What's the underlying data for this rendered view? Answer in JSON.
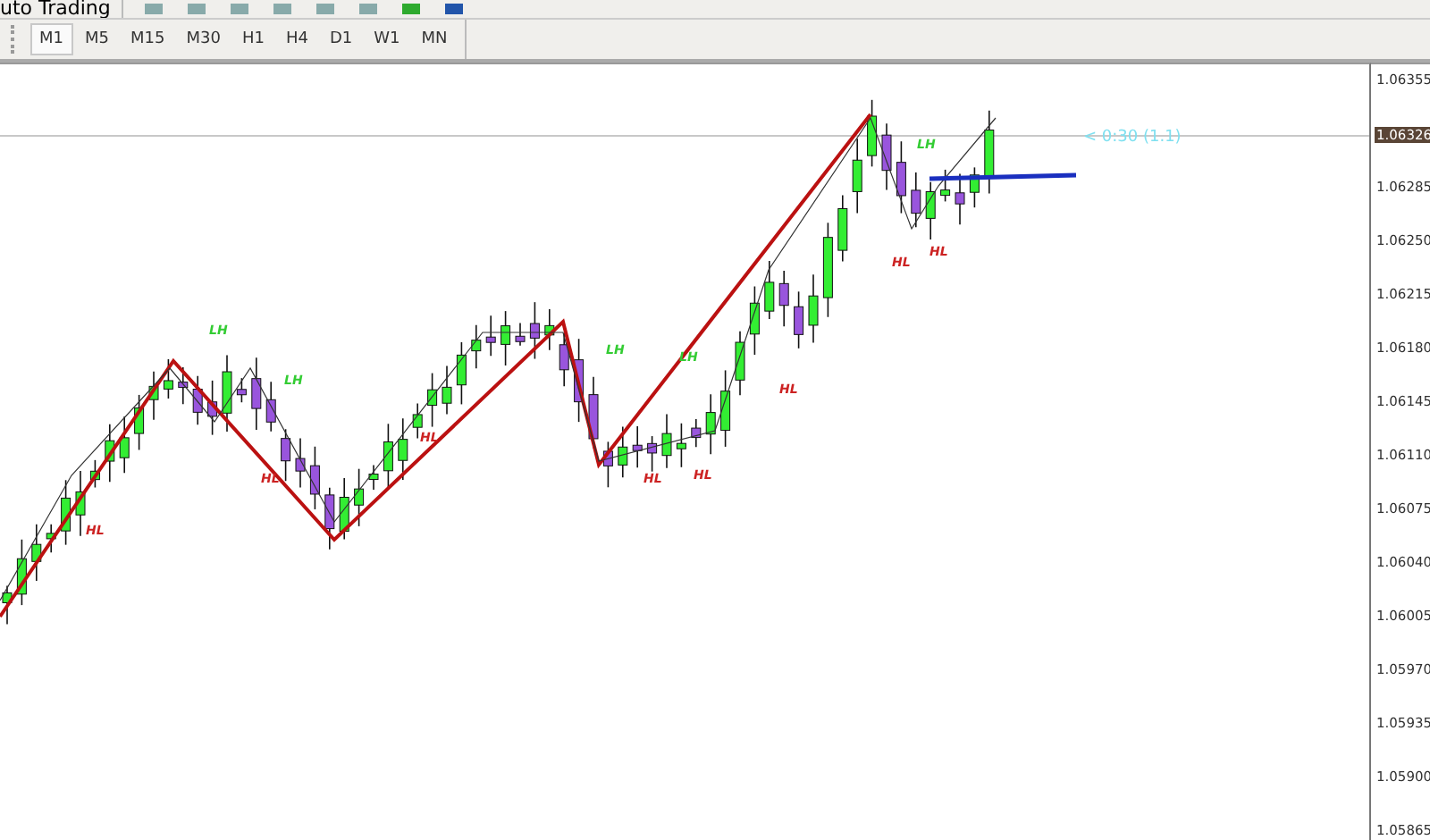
{
  "toolbar": {
    "auto_trading_label": "uto Trading"
  },
  "timeframes": [
    {
      "label": "M1",
      "selected": true
    },
    {
      "label": "M5",
      "selected": false
    },
    {
      "label": "M15",
      "selected": false
    },
    {
      "label": "M30",
      "selected": false
    },
    {
      "label": "H1",
      "selected": false
    },
    {
      "label": "H4",
      "selected": false
    },
    {
      "label": "D1",
      "selected": false
    },
    {
      "label": "W1",
      "selected": false
    },
    {
      "label": "MN",
      "selected": false
    }
  ],
  "chart": {
    "price_axis": [
      "1.06355",
      "1.06285",
      "1.06250",
      "1.06215",
      "1.06180",
      "1.06145",
      "1.06110",
      "1.06075",
      "1.06040",
      "1.06005",
      "1.05970",
      "1.05935",
      "1.05900",
      "1.05865"
    ],
    "current_price": "1.06326",
    "countdown": "< 0:30 (1.1)",
    "swing_labels": [
      {
        "text": "LH",
        "color": "#33cc33"
      },
      {
        "text": "LH",
        "color": "#33cc33"
      },
      {
        "text": "LH",
        "color": "#33cc33"
      },
      {
        "text": "LH",
        "color": "#33cc33"
      },
      {
        "text": "LH",
        "color": "#33cc33"
      },
      {
        "text": "HL",
        "color": "#cc2222"
      },
      {
        "text": "HL",
        "color": "#cc2222"
      },
      {
        "text": "HL",
        "color": "#cc2222"
      },
      {
        "text": "HL",
        "color": "#cc2222"
      },
      {
        "text": "HL",
        "color": "#cc2222"
      },
      {
        "text": "HL",
        "color": "#cc2222"
      },
      {
        "text": "HL",
        "color": "#cc2222"
      },
      {
        "text": "HL",
        "color": "#cc2222"
      }
    ]
  }
}
